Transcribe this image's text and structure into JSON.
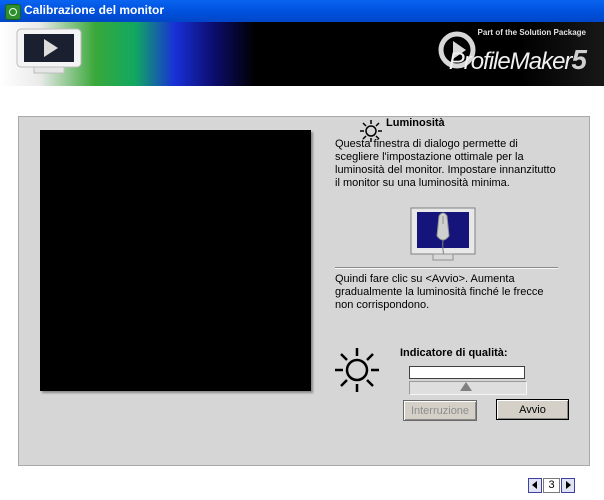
{
  "window": {
    "title": "Calibrazione del monitor"
  },
  "banner": {
    "tagline": "Part of the Solution Package",
    "brand": "ProfileMaker",
    "version": "5"
  },
  "content": {
    "heading": "Luminosità",
    "paragraph1": "Questa finestra di dialogo permette di scegliere l'impostazione ottimale per la luminosità del monitor. Impostare innanzitutto il monitor su una luminosità minima.",
    "paragraph2": "Quindi fare clic su <Avvio>. Aumenta gradualmente la luminosità finché le frecce non corrispondono.",
    "quality_label": "Indicatore di qualità:",
    "quality_value": 0,
    "slider_position": 0.5
  },
  "buttons": {
    "interrupt": "Interruzione",
    "start": "Avvio"
  },
  "pager": {
    "current_page": "3"
  },
  "colors": {
    "title_bar": "#0055e5",
    "panel": "#d6d6d6",
    "preview": "#000000"
  }
}
